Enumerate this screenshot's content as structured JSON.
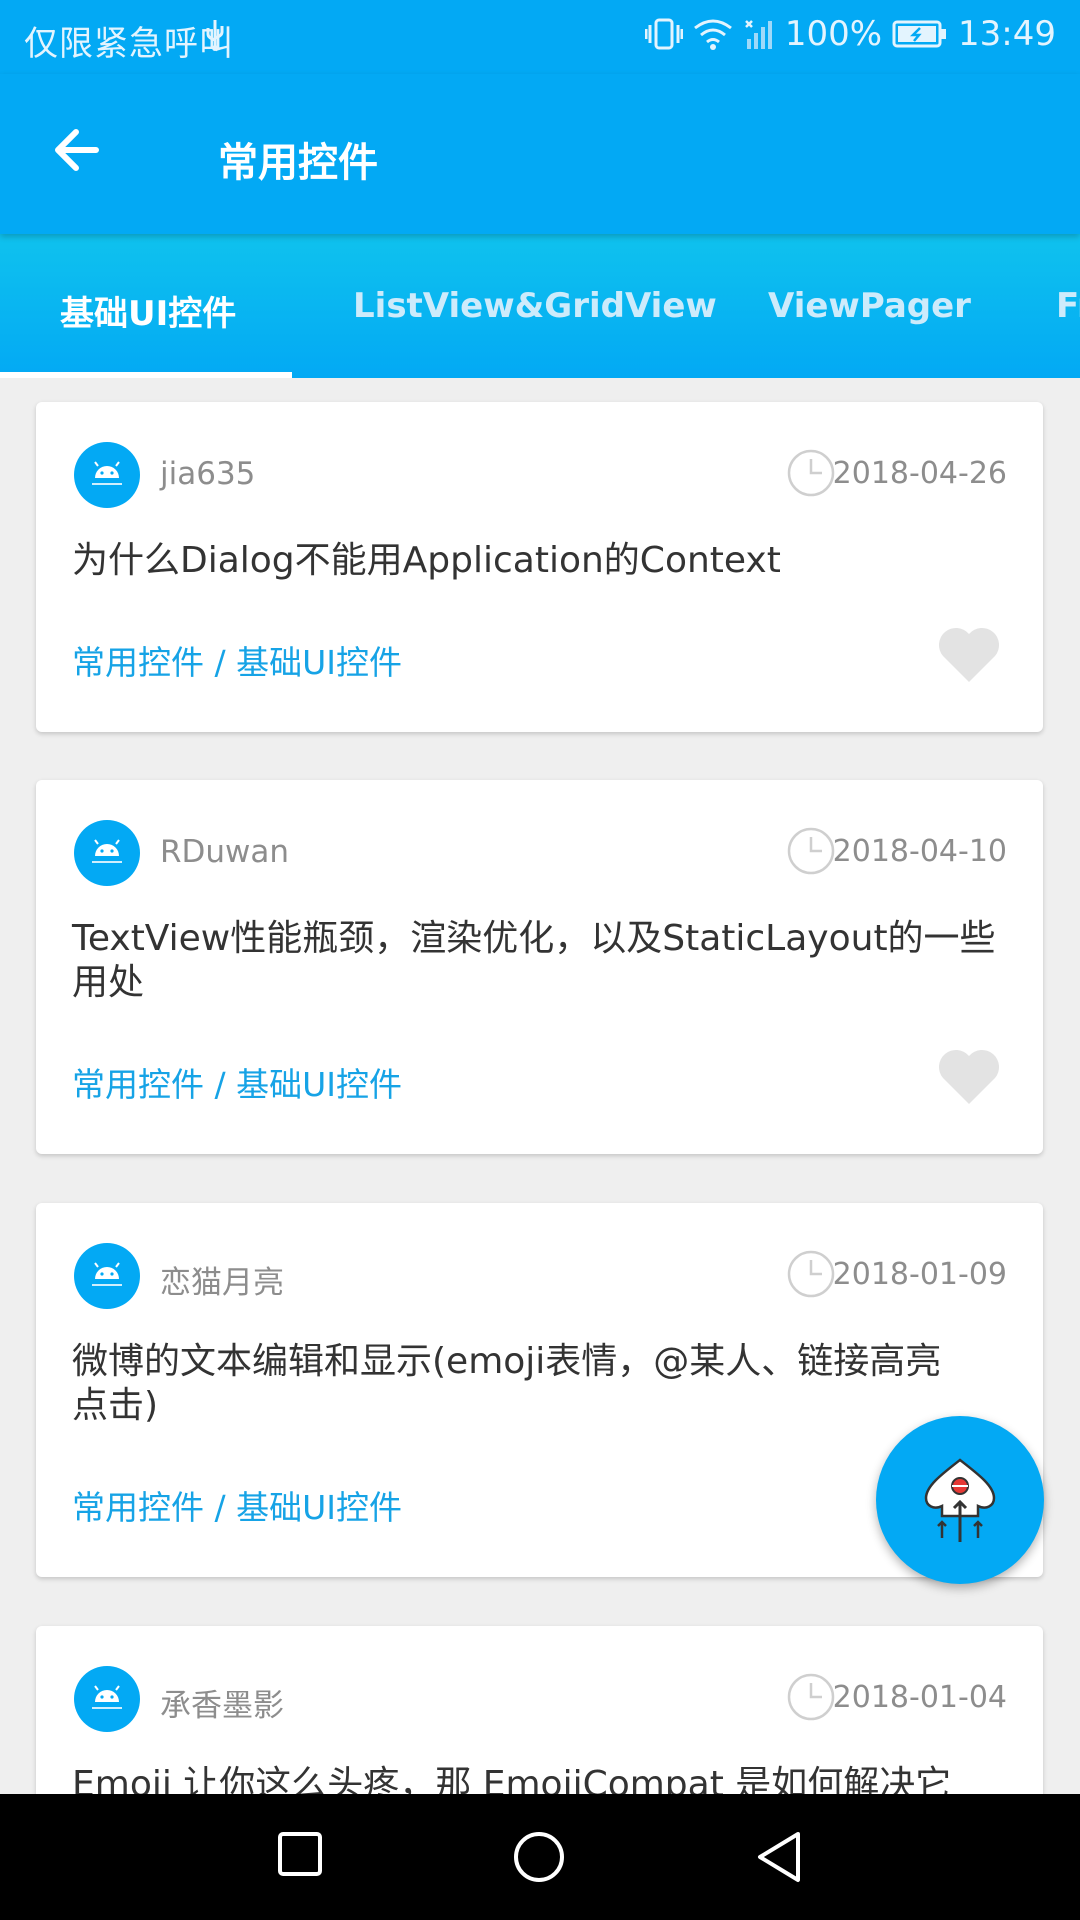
{
  "status_bar": {
    "carrier": "仅限紧急呼叫",
    "battery": "100%",
    "time": "13:49"
  },
  "toolbar": {
    "title": "常用控件",
    "back_icon": "arrow-left-icon"
  },
  "tabs": [
    {
      "label": "基础UI控件",
      "active": true
    },
    {
      "label": "ListView&GridView",
      "active": false
    },
    {
      "label": "ViewPager",
      "active": false
    },
    {
      "label": "Fr",
      "active": false
    }
  ],
  "articles": [
    {
      "author": "jia635",
      "date": "2018-04-26",
      "title_lines": [
        "为什么Dialog不能用Application的Context"
      ],
      "chapter": "常用控件 / 基础UI控件"
    },
    {
      "author": "RDuwan",
      "date": "2018-04-10",
      "title_lines": [
        "TextView性能瓶颈，渲染优化，以及StaticLayout的一些",
        "用处"
      ],
      "chapter": "常用控件 / 基础UI控件"
    },
    {
      "author": "恋猫月亮",
      "date": "2018-01-09",
      "title_lines": [
        "微博的文本编辑和显示(emoji表情，@某人、链接高亮",
        "点击)"
      ],
      "chapter": "常用控件 / 基础UI控件"
    },
    {
      "author": "承香墨影",
      "date": "2018-01-04",
      "title_lines": [
        "Emoji 让你这么头疼，那 EmojiCompat 是如何解决它"
      ],
      "chapter": ""
    }
  ],
  "colors": {
    "primary": "#03a9f4",
    "chapter_text": "#16a3e6",
    "favorite_inactive": "#e3e3e3"
  },
  "icons": {
    "fab": "rocket-scroll-top-icon",
    "nav": [
      "square-recents-icon",
      "circle-home-icon",
      "triangle-back-icon"
    ]
  }
}
